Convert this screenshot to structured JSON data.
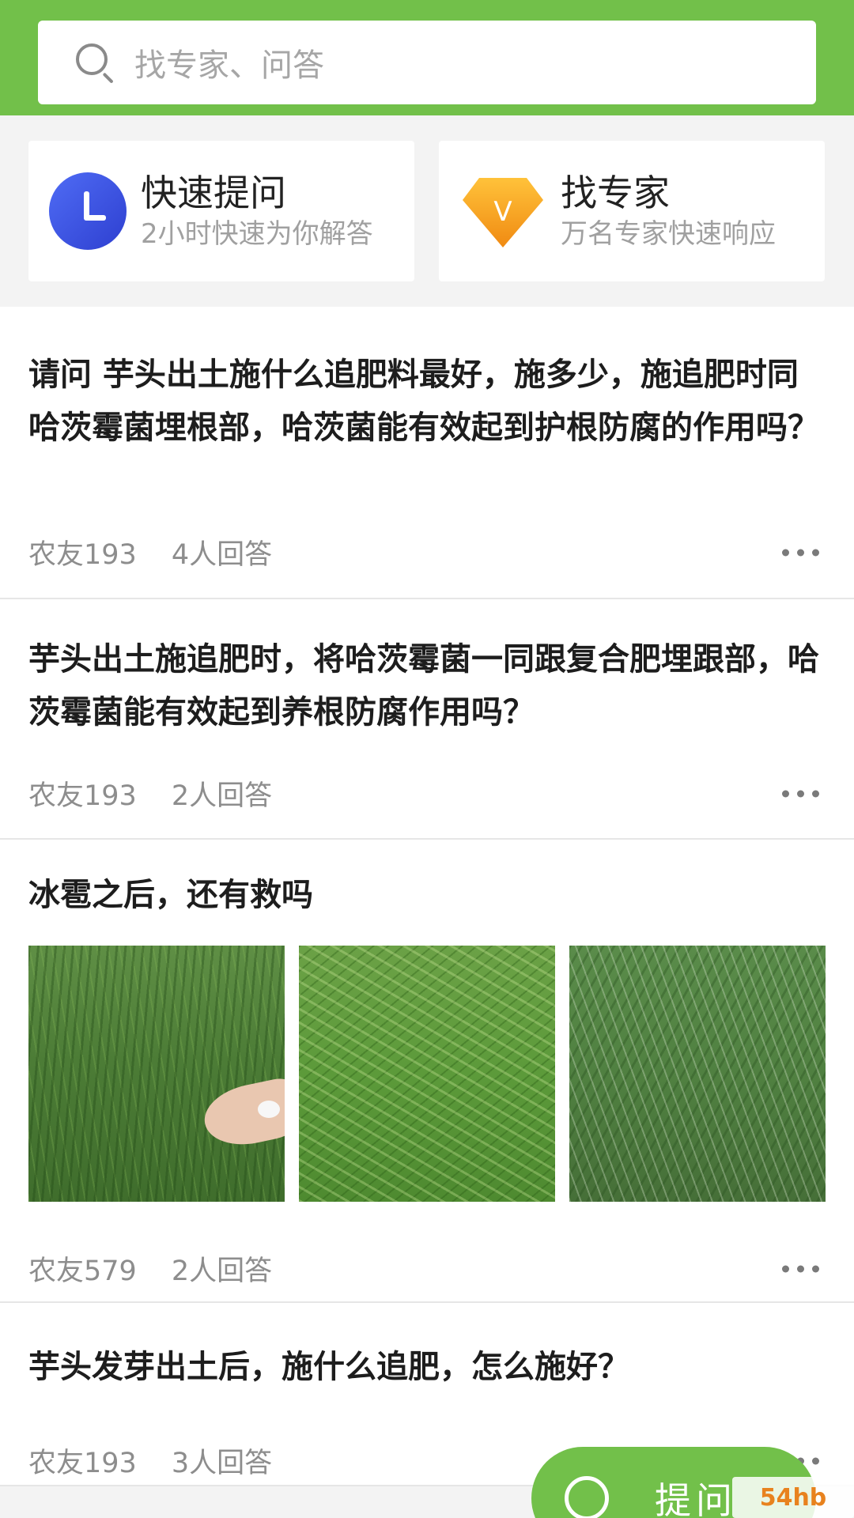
{
  "search": {
    "placeholder": "找专家、问答"
  },
  "shortcuts": [
    {
      "title": "快速提问",
      "subtitle": "2小时快速为你解答",
      "icon": "clock-icon",
      "color": "#3f56e6"
    },
    {
      "title": "找专家",
      "subtitle": "万名专家快速响应",
      "icon": "v-diamond-icon",
      "color": "#f5a31a"
    }
  ],
  "posts": [
    {
      "title": "请问 芋头出土施什么追肥料最好，施多少，施追肥时同哈茨霉菌埋根部，哈茨菌能有效起到护根防腐的作用吗？",
      "author": "农友193",
      "answers": "4人回答"
    },
    {
      "title": "芋头出土施追肥时，将哈茨霉菌一同跟复合肥埋跟部，哈茨霉菌能有效起到养根防腐作用吗？",
      "author": "农友193",
      "answers": "2人回答"
    },
    {
      "title": "冰雹之后，还有救吗",
      "author": "农友579",
      "answers": "2人回答",
      "images": [
        "hail-field-photo",
        "flattened-crop-photo",
        "damaged-field-photo"
      ]
    },
    {
      "title": "芋头发芽出土后，施什么追肥，怎么施好？",
      "author": "农友193",
      "answers": "3人回答"
    }
  ],
  "fab": {
    "label": "提问"
  },
  "watermark": {
    "text": "54hb"
  },
  "colors": {
    "accent": "#72c04a",
    "text": "#1d1d1d",
    "muted": "#8d8d8d"
  }
}
